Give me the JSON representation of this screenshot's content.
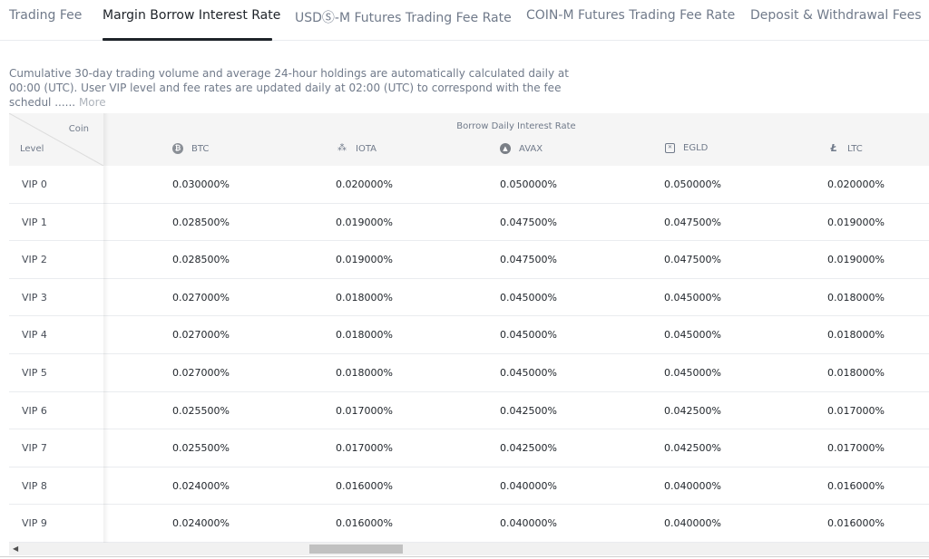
{
  "tabs": [
    {
      "label": "Trading Fee"
    },
    {
      "label": "Margin Borrow Interest Rate"
    },
    {
      "label": "USDⓈ-M Futures Trading Fee Rate"
    },
    {
      "label": "COIN-M Futures Trading Fee Rate"
    },
    {
      "label": "Deposit & Withdrawal Fees"
    }
  ],
  "active_tab": "Margin Borrow Interest Rate",
  "description": {
    "text": "Cumulative 30-day trading volume and average 24-hour holdings are automatically calculated daily at 00:00 (UTC). User VIP level and fee rates are updated daily at 02:00 (UTC) to correspond with the fee schedul ......",
    "more_label": "More"
  },
  "table": {
    "corner_coin": "Coin",
    "corner_level": "Level",
    "group_title": "Borrow Daily Interest Rate",
    "coins": [
      {
        "name": "BTC",
        "icon": "btc-icon",
        "glyph": "₿"
      },
      {
        "name": "IOTA",
        "icon": "iota-icon",
        "glyph": "⁂"
      },
      {
        "name": "AVAX",
        "icon": "avax-icon",
        "glyph": "▲"
      },
      {
        "name": "EGLD",
        "icon": "egld-icon",
        "glyph": "✕"
      },
      {
        "name": "LTC",
        "icon": "ltc-icon",
        "glyph": "Ł"
      }
    ],
    "rows": [
      {
        "level": "VIP 0",
        "values": [
          "0.030000%",
          "0.020000%",
          "0.050000%",
          "0.050000%",
          "0.020000%"
        ]
      },
      {
        "level": "VIP 1",
        "values": [
          "0.028500%",
          "0.019000%",
          "0.047500%",
          "0.047500%",
          "0.019000%"
        ]
      },
      {
        "level": "VIP 2",
        "values": [
          "0.028500%",
          "0.019000%",
          "0.047500%",
          "0.047500%",
          "0.019000%"
        ]
      },
      {
        "level": "VIP 3",
        "values": [
          "0.027000%",
          "0.018000%",
          "0.045000%",
          "0.045000%",
          "0.018000%"
        ]
      },
      {
        "level": "VIP 4",
        "values": [
          "0.027000%",
          "0.018000%",
          "0.045000%",
          "0.045000%",
          "0.018000%"
        ]
      },
      {
        "level": "VIP 5",
        "values": [
          "0.027000%",
          "0.018000%",
          "0.045000%",
          "0.045000%",
          "0.018000%"
        ]
      },
      {
        "level": "VIP 6",
        "values": [
          "0.025500%",
          "0.017000%",
          "0.042500%",
          "0.042500%",
          "0.017000%"
        ]
      },
      {
        "level": "VIP 7",
        "values": [
          "0.025500%",
          "0.017000%",
          "0.042500%",
          "0.042500%",
          "0.017000%"
        ]
      },
      {
        "level": "VIP 8",
        "values": [
          "0.024000%",
          "0.016000%",
          "0.040000%",
          "0.040000%",
          "0.016000%"
        ]
      },
      {
        "level": "VIP 9",
        "values": [
          "0.024000%",
          "0.016000%",
          "0.040000%",
          "0.040000%",
          "0.016000%"
        ]
      }
    ]
  },
  "scrollbar": {
    "left_arrow": "◀"
  }
}
